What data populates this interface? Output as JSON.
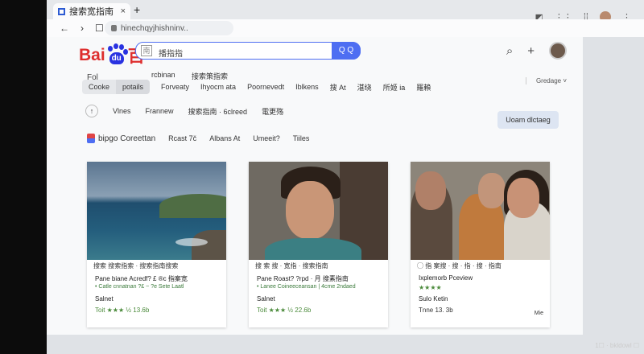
{
  "browser": {
    "tab_title": "搜索宽指南",
    "tab_close": "×",
    "new_tab": "+",
    "url": "hinechqyjhishninv.."
  },
  "page": {
    "logo_left": "Bai",
    "logo_mid": "du",
    "logo_right": "百",
    "search_icon_text": "南",
    "search_text": "播指指",
    "search_button": "Q Q",
    "fol": "Fol",
    "tab_cooke": "Cooke",
    "tab_potails": "potails",
    "above_1": "rcbinan",
    "above_2": "接索策指索",
    "row1_items": [
      "Forveaty",
      "Ihyocm ata",
      "Poornevedt",
      "Iblkens",
      "搜 At",
      "湛绕",
      "所姬 ia",
      "羅賴"
    ],
    "right_dropdown": "Gredage",
    "row2_items": [
      "Vlnes",
      "Frannew",
      "搜索指南 · 6clreed",
      "電更殇"
    ],
    "cta": "Uoam dlctaeg",
    "row3_brand": "bipgo Coreettan",
    "row3_items": [
      "Rcast 7č",
      "Albans At",
      "Umeeit?",
      "Tiiles"
    ]
  },
  "cards": [
    {
      "caption": "搜索 搜索指索 · 搜索指南搜索",
      "title": "Pane biane Acredf? £ ®c 指案宽",
      "sub": "• Catle cnnatnan ?£ ~ ?e Sete Laatl",
      "meta": "Salnet",
      "rating": "Toit ★★★ ½ 13.6b",
      "more": ""
    },
    {
      "caption": "搜 索 搜 · 宽指 · 搜索指南",
      "title": "Pane Roast? ?rpd · 月 搜素指南",
      "sub": "• Lanee Coineeceansan | 4cme 2ndaed",
      "meta": "Salnet",
      "rating": "Toit ★★★ ½ 22.6b",
      "more": ""
    },
    {
      "caption": "◯ 指 案搜 · 搜 · 指 · 搜 · 指南",
      "title": "Ixplemorb Pceview",
      "sub": "★★★★",
      "meta": "Sulo Ketin",
      "rating": "Tnne 13. 3b",
      "more": "Mie"
    }
  ],
  "taskbar": {
    "clock": "1☐ · bkldowl ☐"
  }
}
